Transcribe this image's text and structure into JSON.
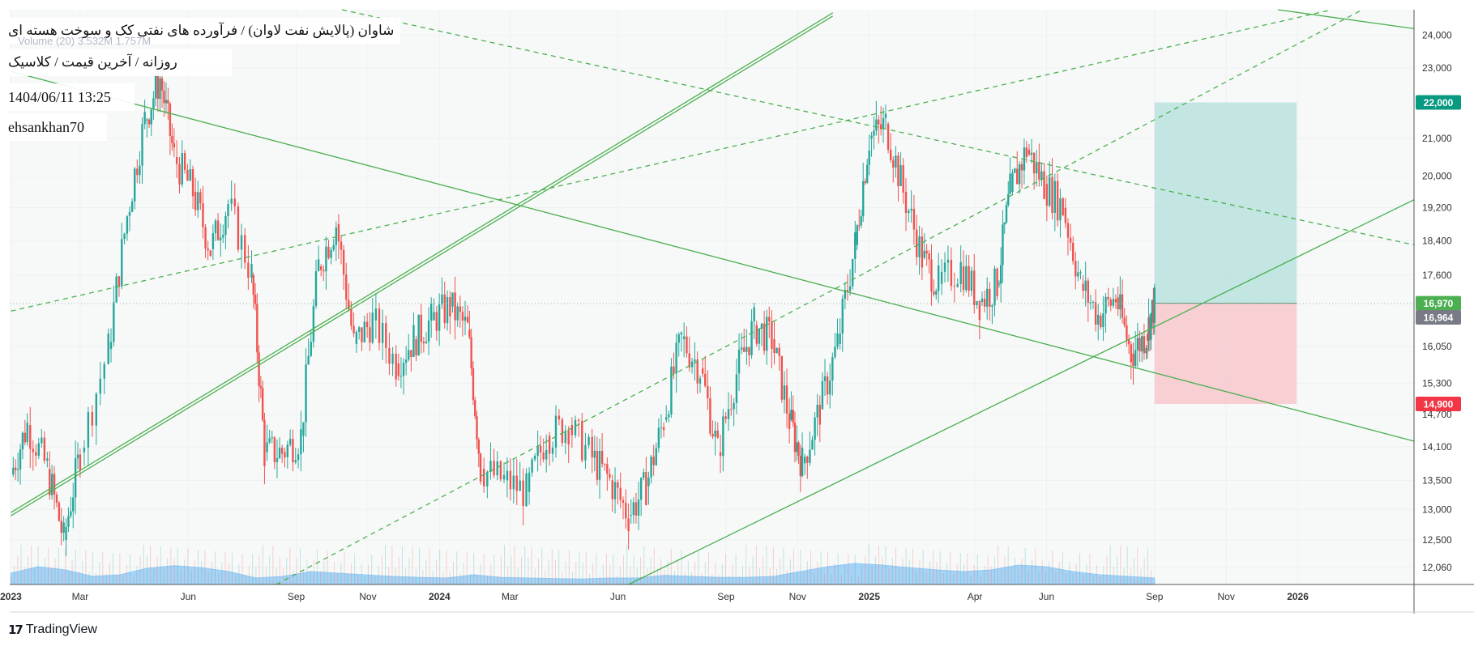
{
  "header": {
    "title": "شاوان (پالایش نفت لاوان) / فرآورده های نفتی کک و سوخت هسته ای",
    "subtitle": "روزانه / آخرین قیمت / کلاسیک",
    "date": "1404/06/11 13:25",
    "author": "ehsankhan70",
    "volume_label": "Volume (20)",
    "volume_values": "3.532M  1.757M"
  },
  "footer": {
    "brand": "TradingView"
  },
  "colors": {
    "background": "#ffffff",
    "grid": "#eef0f3",
    "up_candle": "#26a69a",
    "down_candle": "#ef5350",
    "trendline": "#4caf50",
    "volume_area": "#64b5f6",
    "target_zone": "#b2dfdb",
    "stop_zone": "#f8c6cb",
    "badge_target": "#089981",
    "badge_entry": "#4caf50",
    "badge_last": "#787b86",
    "badge_stop": "#f23645"
  },
  "chart_data": {
    "type": "candlestick",
    "title": "شاوان (پالایش نفت لاوان) / فرآورده های نفتی کک و سوخت هسته ای",
    "timeframe": "روزانه",
    "x_axis_labels": [
      "2023",
      "Mar",
      "Jun",
      "Sep",
      "Nov",
      "2024",
      "Mar",
      "Jun",
      "Sep",
      "Nov",
      "2025",
      "Apr",
      "Jun",
      "Sep",
      "Nov",
      "2026"
    ],
    "x_axis_dates": [
      "2023-01-01",
      "2023-03-01",
      "2023-06-01",
      "2023-09-01",
      "2023-11-01",
      "2024-01-01",
      "2024-03-01",
      "2024-06-01",
      "2024-09-01",
      "2024-11-01",
      "2025-01-01",
      "2025-04-01",
      "2025-06-01",
      "2025-09-01",
      "2025-11-01",
      "2026-01-01"
    ],
    "y_axis_labels": [
      "24,000",
      "23,000",
      "22,000",
      "21,000",
      "20,000",
      "19,200",
      "18,400",
      "17,600",
      "16,970",
      "16,964",
      "16,050",
      "15,300",
      "14,900",
      "14,700",
      "14,100",
      "13,500",
      "13,000",
      "12,500",
      "12,060"
    ],
    "y_axis_scale": "log",
    "ylim": [
      11800,
      24800
    ],
    "xlim": [
      "2022-12-31",
      "2026-04-10"
    ],
    "price_path": [
      {
        "date": "2023-01-01",
        "price": 13600
      },
      {
        "date": "2023-01-15",
        "price": 14500
      },
      {
        "date": "2023-02-01",
        "price": 13700
      },
      {
        "date": "2023-02-15",
        "price": 12500
      },
      {
        "date": "2023-03-01",
        "price": 14000
      },
      {
        "date": "2023-03-25",
        "price": 16000
      },
      {
        "date": "2023-04-10",
        "price": 19000
      },
      {
        "date": "2023-04-25",
        "price": 21500
      },
      {
        "date": "2023-05-08",
        "price": 22700
      },
      {
        "date": "2023-05-20",
        "price": 20500
      },
      {
        "date": "2023-06-05",
        "price": 19600
      },
      {
        "date": "2023-06-20",
        "price": 18200
      },
      {
        "date": "2023-07-05",
        "price": 19300
      },
      {
        "date": "2023-07-25",
        "price": 17600
      },
      {
        "date": "2023-08-05",
        "price": 14000
      },
      {
        "date": "2023-08-20",
        "price": 14000
      },
      {
        "date": "2023-09-05",
        "price": 14300
      },
      {
        "date": "2023-09-20",
        "price": 17800
      },
      {
        "date": "2023-10-05",
        "price": 18800
      },
      {
        "date": "2023-10-20",
        "price": 16100
      },
      {
        "date": "2023-11-05",
        "price": 16600
      },
      {
        "date": "2023-11-25",
        "price": 15700
      },
      {
        "date": "2023-12-10",
        "price": 16200
      },
      {
        "date": "2023-12-25",
        "price": 16600
      },
      {
        "date": "2024-01-10",
        "price": 16900
      },
      {
        "date": "2024-01-25",
        "price": 16400
      },
      {
        "date": "2024-02-05",
        "price": 13700
      },
      {
        "date": "2024-02-25",
        "price": 13500
      },
      {
        "date": "2024-03-15",
        "price": 13300
      },
      {
        "date": "2024-04-01",
        "price": 14300
      },
      {
        "date": "2024-04-20",
        "price": 14500
      },
      {
        "date": "2024-05-10",
        "price": 13900
      },
      {
        "date": "2024-05-25",
        "price": 13500
      },
      {
        "date": "2024-06-10",
        "price": 12900
      },
      {
        "date": "2024-06-25",
        "price": 13400
      },
      {
        "date": "2024-07-10",
        "price": 14600
      },
      {
        "date": "2024-07-25",
        "price": 16200
      },
      {
        "date": "2024-08-10",
        "price": 15600
      },
      {
        "date": "2024-08-25",
        "price": 14000
      },
      {
        "date": "2024-09-10",
        "price": 15500
      },
      {
        "date": "2024-09-25",
        "price": 16500
      },
      {
        "date": "2024-10-10",
        "price": 16200
      },
      {
        "date": "2024-10-25",
        "price": 14600
      },
      {
        "date": "2024-11-05",
        "price": 13800
      },
      {
        "date": "2024-11-20",
        "price": 14800
      },
      {
        "date": "2024-12-05",
        "price": 16100
      },
      {
        "date": "2024-12-20",
        "price": 18300
      },
      {
        "date": "2025-01-01",
        "price": 21000
      },
      {
        "date": "2025-01-15",
        "price": 21400
      },
      {
        "date": "2025-01-30",
        "price": 19600
      },
      {
        "date": "2025-02-15",
        "price": 18000
      },
      {
        "date": "2025-03-01",
        "price": 17400
      },
      {
        "date": "2025-03-20",
        "price": 17800
      },
      {
        "date": "2025-04-05",
        "price": 17000
      },
      {
        "date": "2025-04-20",
        "price": 17400
      },
      {
        "date": "2025-05-01",
        "price": 19600
      },
      {
        "date": "2025-05-15",
        "price": 20700
      },
      {
        "date": "2025-05-30",
        "price": 19800
      },
      {
        "date": "2025-06-15",
        "price": 19200
      },
      {
        "date": "2025-06-30",
        "price": 17400
      },
      {
        "date": "2025-07-15",
        "price": 16700
      },
      {
        "date": "2025-07-30",
        "price": 17100
      },
      {
        "date": "2025-08-12",
        "price": 15900
      },
      {
        "date": "2025-08-25",
        "price": 16300
      },
      {
        "date": "2025-09-01",
        "price": 16964
      }
    ],
    "volume_profile": [
      0.25,
      0.45,
      0.35,
      0.15,
      0.2,
      0.4,
      0.48,
      0.42,
      0.3,
      0.1,
      0.15,
      0.3,
      0.25,
      0.2,
      0.15,
      0.12,
      0.1,
      0.2,
      0.12,
      0.1,
      0.08,
      0.07,
      0.1,
      0.1,
      0.18,
      0.15,
      0.12,
      0.12,
      0.15,
      0.3,
      0.45,
      0.55,
      0.5,
      0.42,
      0.35,
      0.3,
      0.35,
      0.5,
      0.45,
      0.3,
      0.2,
      0.15,
      0.1
    ],
    "last_price": 16964,
    "position": {
      "entry": 16970,
      "target": 22000,
      "stop": 14900,
      "start_date": "2025-09-01",
      "end_date": "2025-12-31"
    },
    "price_badges": [
      {
        "label": "22,000",
        "value": 22000,
        "kind": "target"
      },
      {
        "label": "16,970",
        "value": 16970,
        "kind": "entry"
      },
      {
        "label": "16,964",
        "value": 16964,
        "kind": "last"
      },
      {
        "label": "14,900",
        "value": 14900,
        "kind": "stop"
      }
    ],
    "trendlines": [
      {
        "style": "solid",
        "double": true,
        "p1": {
          "date": "2023-01-01",
          "price": 12950
        },
        "p2": {
          "date": "2024-12-01",
          "price": 24700
        }
      },
      {
        "style": "solid",
        "p1": {
          "date": "2023-01-01",
          "price": 22900
        },
        "p2": {
          "date": "2026-04-10",
          "price": 14200
        }
      },
      {
        "style": "solid",
        "p1": {
          "date": "2024-06-10",
          "price": 11800
        },
        "p2": {
          "date": "2026-04-10",
          "price": 19400
        }
      },
      {
        "style": "dashed",
        "p1": {
          "date": "2023-01-01",
          "price": 16800
        },
        "p2": {
          "date": "2026-01-30",
          "price": 24800
        }
      },
      {
        "style": "dashed",
        "p1": {
          "date": "2023-08-15",
          "price": 11800
        },
        "p2": {
          "date": "2026-02-25",
          "price": 24800
        }
      },
      {
        "style": "dashed",
        "p1": {
          "date": "2023-10-10",
          "price": 24800
        },
        "p2": {
          "date": "2026-04-10",
          "price": 18300
        }
      },
      {
        "style": "solid",
        "p1": {
          "date": "2025-12-15",
          "price": 24800
        },
        "p2": {
          "date": "2026-04-10",
          "price": 24200
        }
      }
    ],
    "grid": true
  }
}
